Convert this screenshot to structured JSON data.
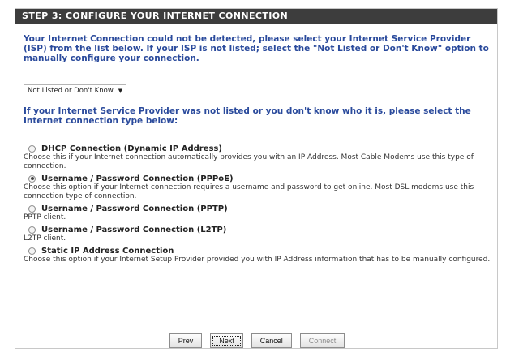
{
  "header": {
    "title": "STEP 3: CONFIGURE YOUR INTERNET CONNECTION"
  },
  "intro_text": "Your Internet Connection could not be detected, please select your Internet Service Provider (ISP) from the list below. If your ISP is not listed; select the \"Not Listed or Don't Know\" option to manually configure your connection.",
  "isp_select": {
    "value": "Not Listed or Don't Know"
  },
  "question_text": "If your Internet Service Provider was not listed or you don't know who it is, please select the Internet connection type below:",
  "options": [
    {
      "label": "DHCP Connection (Dynamic IP Address)",
      "description": "Choose this if your Internet connection automatically provides you with an IP Address. Most Cable Modems use this type of connection.",
      "checked": false
    },
    {
      "label": "Username / Password Connection (PPPoE)",
      "description": "Choose this option if your Internet connection requires a username and password to get online. Most DSL modems use this connection type of connection.",
      "checked": true
    },
    {
      "label": "Username / Password Connection (PPTP)",
      "description": "PPTP client.",
      "checked": false
    },
    {
      "label": "Username / Password Connection (L2TP)",
      "description": "L2TP client.",
      "checked": false
    },
    {
      "label": "Static IP Address Connection",
      "description": "Choose this option if your Internet Setup Provider provided you with IP Address information that has to be manually configured.",
      "checked": false
    }
  ],
  "buttons": {
    "prev": "Prev",
    "next": "Next",
    "cancel": "Cancel",
    "connect": "Connect"
  },
  "colors": {
    "header_bg": "#3d3d3d",
    "accent_text": "#2a4a9c"
  }
}
